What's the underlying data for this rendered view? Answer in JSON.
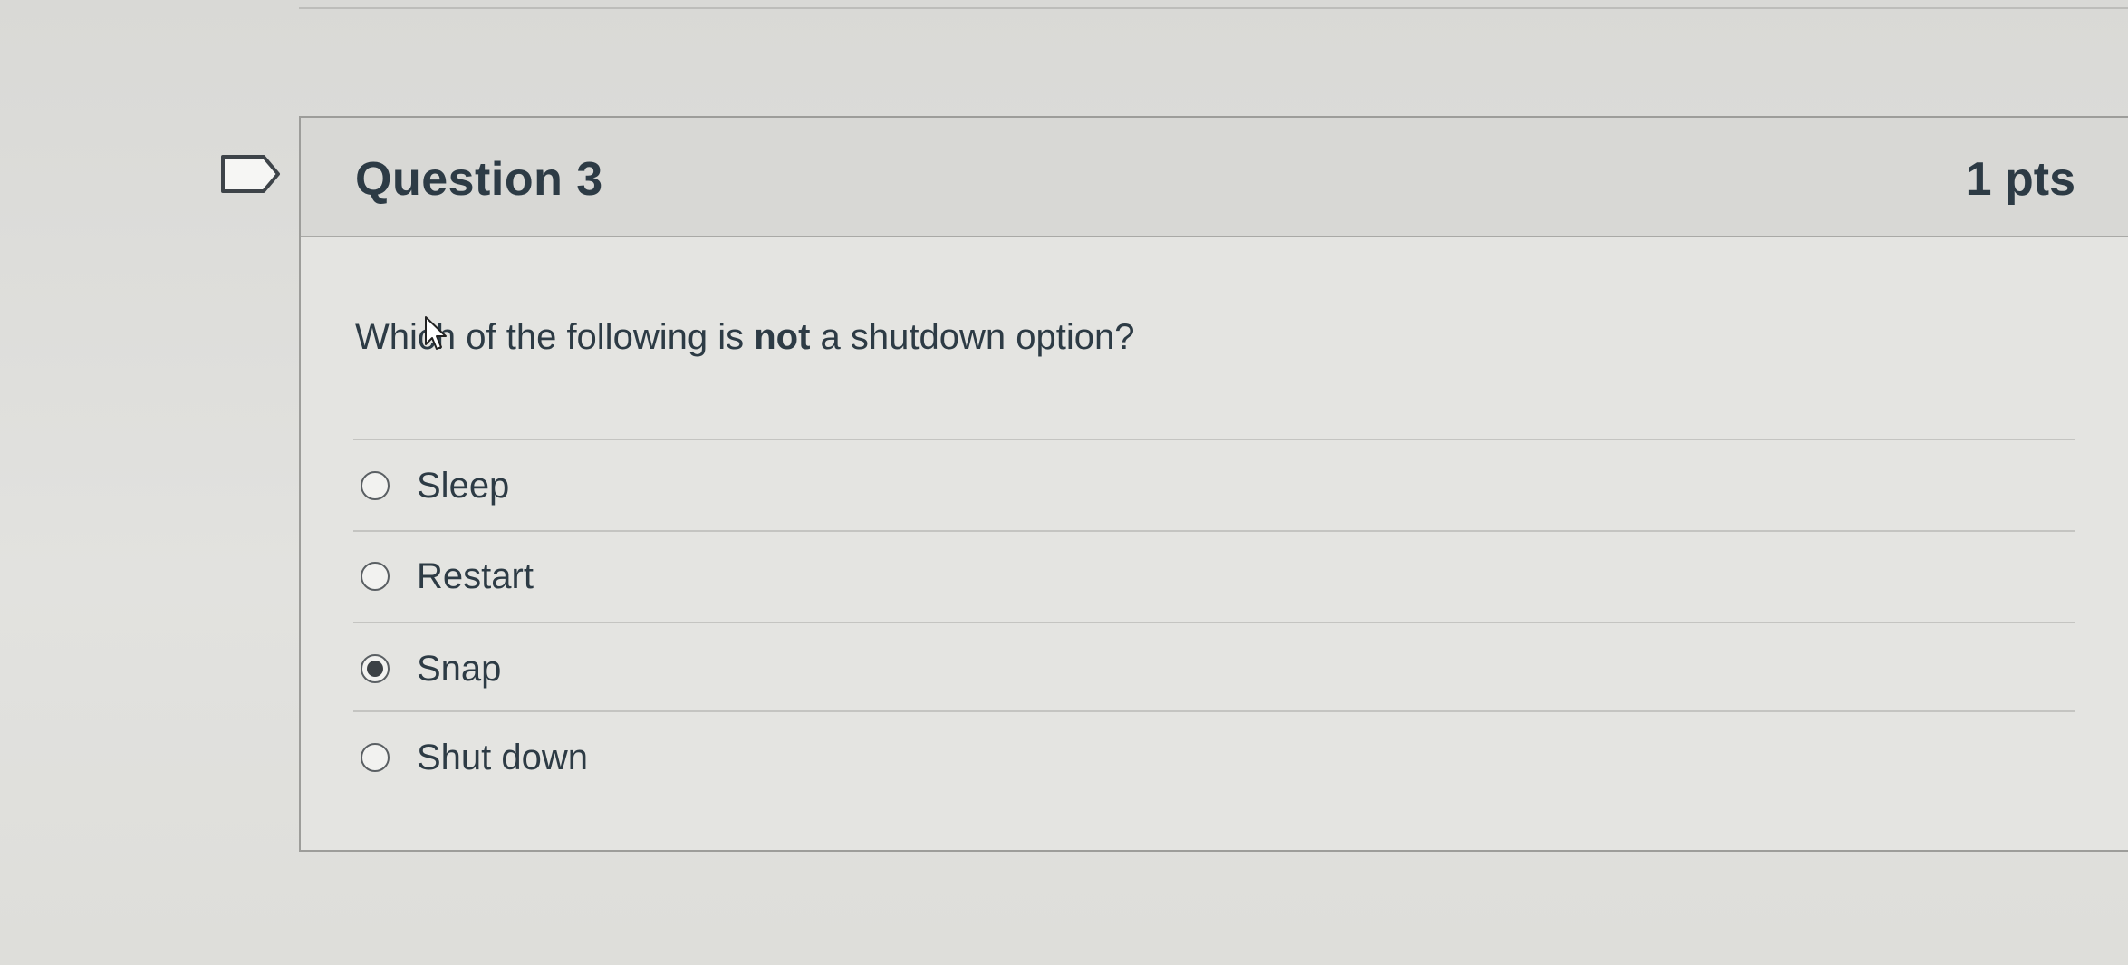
{
  "question": {
    "title": "Question 3",
    "points": "1 pts",
    "text_before": "Which of the following is ",
    "text_bold": "not",
    "text_after": " a shutdown option?"
  },
  "answers": [
    {
      "label": "Sleep",
      "selected": false
    },
    {
      "label": "Restart",
      "selected": false
    },
    {
      "label": "Snap",
      "selected": true
    },
    {
      "label": "Shut down",
      "selected": false
    }
  ],
  "icons": {
    "flag": "flag-icon",
    "cursor": "mouse-pointer-icon"
  },
  "colors": {
    "text": "#2d3b45",
    "header_bg": "#d8d8d5",
    "card_bg": "#e4e4e1"
  }
}
